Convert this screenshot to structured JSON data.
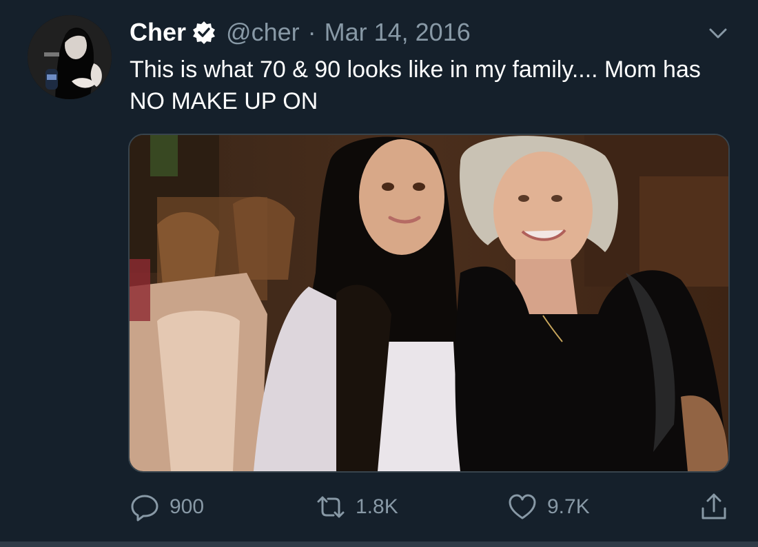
{
  "tweet": {
    "display_name": "Cher",
    "handle": "@cher",
    "separator": "·",
    "date": "Mar 14, 2016",
    "text": "This is what 70 & 90 looks like in my family.... Mom has NO MAKE UP ON",
    "verified": true,
    "avatar_icon": "profile-photo",
    "media_description_icon": "photo"
  },
  "actions": {
    "reply": {
      "icon": "reply-icon",
      "count": "900"
    },
    "retweet": {
      "icon": "retweet-icon",
      "count": "1.8K"
    },
    "like": {
      "icon": "heart-icon",
      "count": "9.7K"
    },
    "share": {
      "icon": "share-icon"
    }
  },
  "colors": {
    "background": "#15202b",
    "primary_text": "#ffffff",
    "secondary_text": "#8899a6",
    "border": "#38444d"
  }
}
